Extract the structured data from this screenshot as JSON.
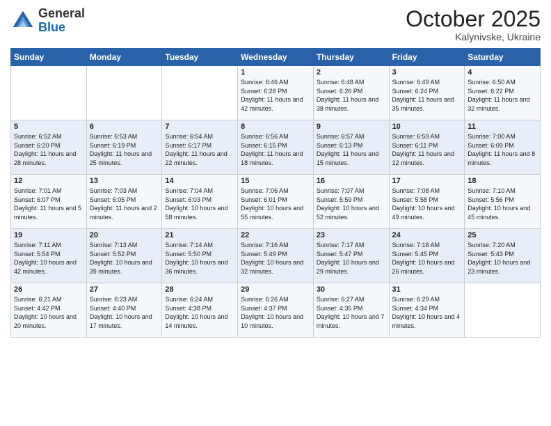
{
  "logo": {
    "general": "General",
    "blue": "Blue"
  },
  "header": {
    "month": "October 2025",
    "location": "Kalynivske, Ukraine"
  },
  "days_of_week": [
    "Sunday",
    "Monday",
    "Tuesday",
    "Wednesday",
    "Thursday",
    "Friday",
    "Saturday"
  ],
  "weeks": [
    [
      {
        "day": "",
        "info": ""
      },
      {
        "day": "",
        "info": ""
      },
      {
        "day": "",
        "info": ""
      },
      {
        "day": "1",
        "info": "Sunrise: 6:46 AM\nSunset: 6:28 PM\nDaylight: 11 hours\nand 42 minutes."
      },
      {
        "day": "2",
        "info": "Sunrise: 6:48 AM\nSunset: 6:26 PM\nDaylight: 11 hours\nand 38 minutes."
      },
      {
        "day": "3",
        "info": "Sunrise: 6:49 AM\nSunset: 6:24 PM\nDaylight: 11 hours\nand 35 minutes."
      },
      {
        "day": "4",
        "info": "Sunrise: 6:50 AM\nSunset: 6:22 PM\nDaylight: 11 hours\nand 32 minutes."
      }
    ],
    [
      {
        "day": "5",
        "info": "Sunrise: 6:52 AM\nSunset: 6:20 PM\nDaylight: 11 hours\nand 28 minutes."
      },
      {
        "day": "6",
        "info": "Sunrise: 6:53 AM\nSunset: 6:19 PM\nDaylight: 11 hours\nand 25 minutes."
      },
      {
        "day": "7",
        "info": "Sunrise: 6:54 AM\nSunset: 6:17 PM\nDaylight: 11 hours\nand 22 minutes."
      },
      {
        "day": "8",
        "info": "Sunrise: 6:56 AM\nSunset: 6:15 PM\nDaylight: 11 hours\nand 18 minutes."
      },
      {
        "day": "9",
        "info": "Sunrise: 6:57 AM\nSunset: 6:13 PM\nDaylight: 11 hours\nand 15 minutes."
      },
      {
        "day": "10",
        "info": "Sunrise: 6:59 AM\nSunset: 6:11 PM\nDaylight: 11 hours\nand 12 minutes."
      },
      {
        "day": "11",
        "info": "Sunrise: 7:00 AM\nSunset: 6:09 PM\nDaylight: 11 hours\nand 8 minutes."
      }
    ],
    [
      {
        "day": "12",
        "info": "Sunrise: 7:01 AM\nSunset: 6:07 PM\nDaylight: 11 hours\nand 5 minutes."
      },
      {
        "day": "13",
        "info": "Sunrise: 7:03 AM\nSunset: 6:05 PM\nDaylight: 11 hours\nand 2 minutes."
      },
      {
        "day": "14",
        "info": "Sunrise: 7:04 AM\nSunset: 6:03 PM\nDaylight: 10 hours\nand 58 minutes."
      },
      {
        "day": "15",
        "info": "Sunrise: 7:06 AM\nSunset: 6:01 PM\nDaylight: 10 hours\nand 55 minutes."
      },
      {
        "day": "16",
        "info": "Sunrise: 7:07 AM\nSunset: 5:59 PM\nDaylight: 10 hours\nand 52 minutes."
      },
      {
        "day": "17",
        "info": "Sunrise: 7:08 AM\nSunset: 5:58 PM\nDaylight: 10 hours\nand 49 minutes."
      },
      {
        "day": "18",
        "info": "Sunrise: 7:10 AM\nSunset: 5:56 PM\nDaylight: 10 hours\nand 45 minutes."
      }
    ],
    [
      {
        "day": "19",
        "info": "Sunrise: 7:11 AM\nSunset: 5:54 PM\nDaylight: 10 hours\nand 42 minutes."
      },
      {
        "day": "20",
        "info": "Sunrise: 7:13 AM\nSunset: 5:52 PM\nDaylight: 10 hours\nand 39 minutes."
      },
      {
        "day": "21",
        "info": "Sunrise: 7:14 AM\nSunset: 5:50 PM\nDaylight: 10 hours\nand 36 minutes."
      },
      {
        "day": "22",
        "info": "Sunrise: 7:16 AM\nSunset: 5:49 PM\nDaylight: 10 hours\nand 32 minutes."
      },
      {
        "day": "23",
        "info": "Sunrise: 7:17 AM\nSunset: 5:47 PM\nDaylight: 10 hours\nand 29 minutes."
      },
      {
        "day": "24",
        "info": "Sunrise: 7:18 AM\nSunset: 5:45 PM\nDaylight: 10 hours\nand 26 minutes."
      },
      {
        "day": "25",
        "info": "Sunrise: 7:20 AM\nSunset: 5:43 PM\nDaylight: 10 hours\nand 23 minutes."
      }
    ],
    [
      {
        "day": "26",
        "info": "Sunrise: 6:21 AM\nSunset: 4:42 PM\nDaylight: 10 hours\nand 20 minutes."
      },
      {
        "day": "27",
        "info": "Sunrise: 6:23 AM\nSunset: 4:40 PM\nDaylight: 10 hours\nand 17 minutes."
      },
      {
        "day": "28",
        "info": "Sunrise: 6:24 AM\nSunset: 4:38 PM\nDaylight: 10 hours\nand 14 minutes."
      },
      {
        "day": "29",
        "info": "Sunrise: 6:26 AM\nSunset: 4:37 PM\nDaylight: 10 hours\nand 10 minutes."
      },
      {
        "day": "30",
        "info": "Sunrise: 6:27 AM\nSunset: 4:35 PM\nDaylight: 10 hours\nand 7 minutes."
      },
      {
        "day": "31",
        "info": "Sunrise: 6:29 AM\nSunset: 4:34 PM\nDaylight: 10 hours\nand 4 minutes."
      },
      {
        "day": "",
        "info": ""
      }
    ]
  ]
}
